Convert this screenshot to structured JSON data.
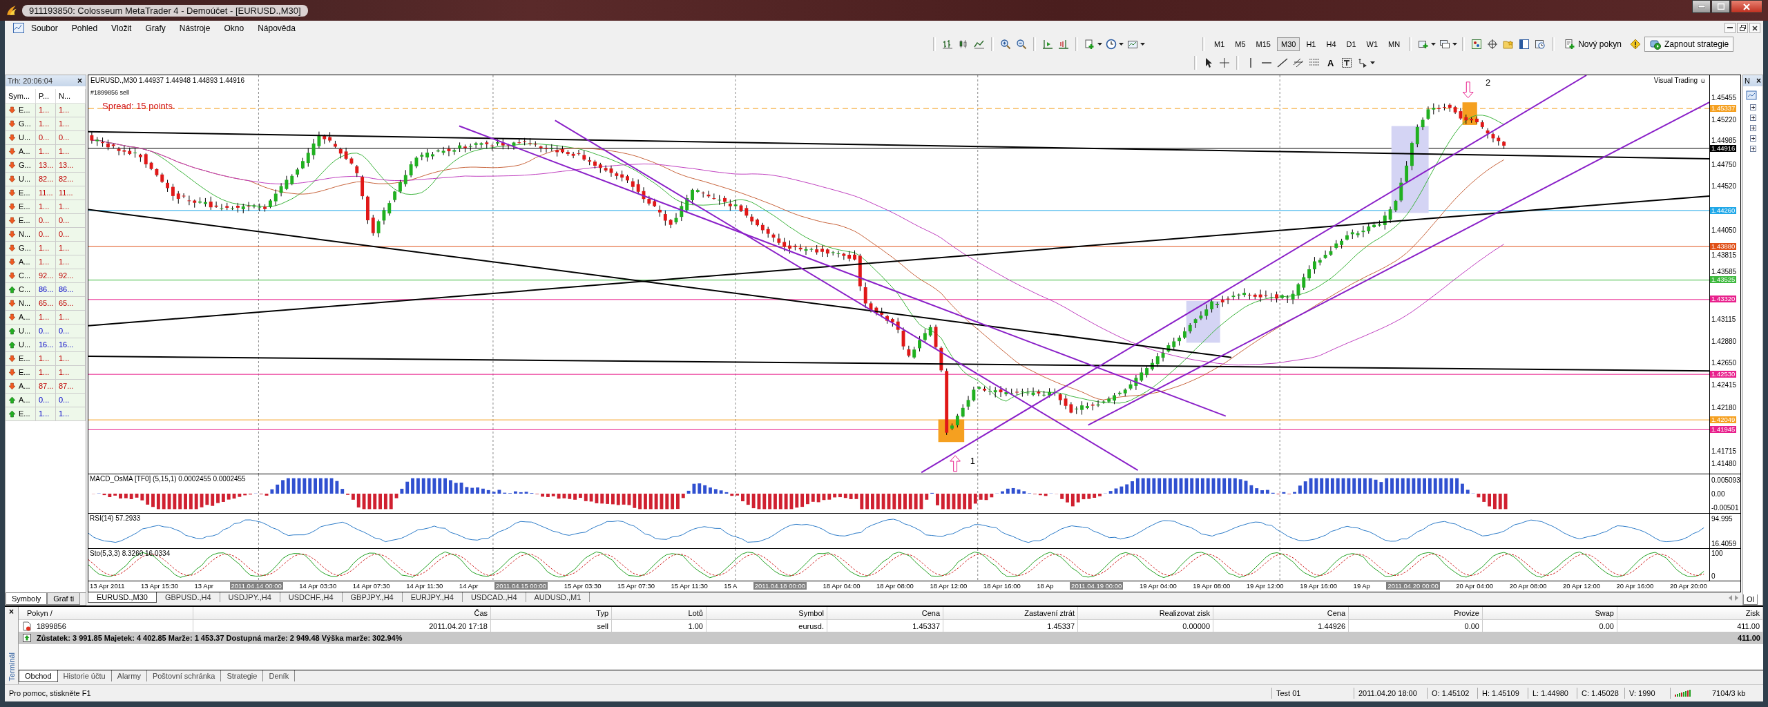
{
  "window": {
    "title": "911193850: Colosseum MetaTrader 4 - Demoúčet - [EURUSD.,M30]"
  },
  "menu": [
    "Soubor",
    "Pohled",
    "Vložit",
    "Grafy",
    "Nástroje",
    "Okno",
    "Nápověda"
  ],
  "toolbar": {
    "timeframes": [
      {
        "label": "M1",
        "selected": false
      },
      {
        "label": "M5",
        "selected": false
      },
      {
        "label": "M15",
        "selected": false
      },
      {
        "label": "M30",
        "selected": true
      },
      {
        "label": "H1",
        "selected": false
      },
      {
        "label": "H4",
        "selected": false
      },
      {
        "label": "D1",
        "selected": false
      },
      {
        "label": "W1",
        "selected": false
      },
      {
        "label": "MN",
        "selected": false
      }
    ],
    "new_order": "Nový pokyn",
    "strategies": "Zapnout strategie",
    "text_tool": "A"
  },
  "market_watch": {
    "title": "Trh: 20:06:04",
    "close": "×",
    "columns": [
      "Sym...",
      "P...",
      "N..."
    ],
    "rows": [
      {
        "symbol": "E...",
        "bid": "1...",
        "ask": "1...",
        "kind": "down"
      },
      {
        "symbol": "G...",
        "bid": "1...",
        "ask": "1...",
        "kind": "down"
      },
      {
        "symbol": "U...",
        "bid": "0...",
        "ask": "0...",
        "kind": "down"
      },
      {
        "symbol": "A...",
        "bid": "1...",
        "ask": "1...",
        "kind": "down"
      },
      {
        "symbol": "G...",
        "bid": "13...",
        "ask": "13...",
        "kind": "down"
      },
      {
        "symbol": "U...",
        "bid": "82...",
        "ask": "82...",
        "kind": "down"
      },
      {
        "symbol": "E...",
        "bid": "11...",
        "ask": "11...",
        "kind": "down"
      },
      {
        "symbol": "E...",
        "bid": "1...",
        "ask": "1...",
        "kind": "down"
      },
      {
        "symbol": "E...",
        "bid": "0...",
        "ask": "0...",
        "kind": "down"
      },
      {
        "symbol": "N...",
        "bid": "0...",
        "ask": "0...",
        "kind": "down"
      },
      {
        "symbol": "G...",
        "bid": "1...",
        "ask": "1...",
        "kind": "down"
      },
      {
        "symbol": "A...",
        "bid": "1...",
        "ask": "1...",
        "kind": "down"
      },
      {
        "symbol": "C...",
        "bid": "92...",
        "ask": "92...",
        "kind": "down"
      },
      {
        "symbol": "C...",
        "bid": "86...",
        "ask": "86...",
        "kind": "up"
      },
      {
        "symbol": "N...",
        "bid": "65...",
        "ask": "65...",
        "kind": "down"
      },
      {
        "symbol": "A...",
        "bid": "1...",
        "ask": "1...",
        "kind": "down"
      },
      {
        "symbol": "U...",
        "bid": "0...",
        "ask": "0...",
        "kind": "up"
      },
      {
        "symbol": "U...",
        "bid": "16...",
        "ask": "16...",
        "kind": "up"
      },
      {
        "symbol": "E...",
        "bid": "1...",
        "ask": "1...",
        "kind": "down"
      },
      {
        "symbol": "E...",
        "bid": "1...",
        "ask": "1...",
        "kind": "down"
      },
      {
        "symbol": "A...",
        "bid": "87...",
        "ask": "87...",
        "kind": "down"
      },
      {
        "symbol": "A...",
        "bid": "0...",
        "ask": "0...",
        "kind": "up"
      },
      {
        "symbol": "E...",
        "bid": "1...",
        "ask": "1...",
        "kind": "up"
      }
    ],
    "tabs": [
      {
        "label": "Symboly",
        "selected": true
      },
      {
        "label": "Graf ti",
        "selected": false
      }
    ]
  },
  "chart": {
    "header": "EURUSD.,M30  1.44937 1.44948 1.44893 1.44916",
    "order_label": "#1899856 sell",
    "spread": "Spread: 15 points.",
    "brand": "Visual Trading ☺",
    "annotations": [
      "1",
      "2"
    ],
    "price_axis": [
      "1.45455",
      "1.45220",
      "1.44985",
      "1.44750",
      "1.44520",
      "1.44050",
      "1.43815",
      "1.43585",
      "1.43115",
      "1.42880",
      "1.42650",
      "1.42415",
      "1.42180",
      "1.41715",
      "1.41480"
    ],
    "price_lines": [
      {
        "price": "1.45337",
        "color": "#f5a020",
        "kind": "order"
      },
      {
        "price": "1.44916",
        "color": "#000000",
        "kind": "bid"
      },
      {
        "price": "1.44260",
        "color": "#20a8e8",
        "kind": "level"
      },
      {
        "price": "1.43880",
        "color": "#e05018",
        "kind": "level"
      },
      {
        "price": "1.43525",
        "color": "#3cb83c",
        "kind": "level"
      },
      {
        "price": "1.43320",
        "color": "#e8208c",
        "kind": "level"
      },
      {
        "price": "1.42530",
        "color": "#e8208c",
        "kind": "level"
      },
      {
        "price": "1.42049",
        "color": "#f5a020",
        "kind": "level"
      },
      {
        "price": "1.41945",
        "color": "#e8208c",
        "kind": "level"
      }
    ],
    "indicators": [
      {
        "kind": "macd",
        "label": "MACD_OsMA [TF0] (5,15,1) 0.0002455 0.0002455",
        "axis": [
          "0.005093",
          "0.00",
          "-0.00501"
        ]
      },
      {
        "kind": "rsi",
        "label": "RSI(14) 57.2933",
        "axis": [
          "94.995",
          "16.4059"
        ]
      },
      {
        "kind": "sto",
        "label": "Sto(5,3,3) 8.3260 16.0334",
        "axis": [
          "100",
          "0"
        ]
      }
    ],
    "time_axis": [
      {
        "label": "13 Apr 2011",
        "kind": "tick"
      },
      {
        "label": "13 Apr 15:30",
        "kind": "tick"
      },
      {
        "label": "13 Apr",
        "kind": "tick"
      },
      {
        "label": "2011.04.14 00:00",
        "kind": "marker"
      },
      {
        "label": "14 Apr 03:30",
        "kind": "tick"
      },
      {
        "label": "14 Apr 07:30",
        "kind": "tick"
      },
      {
        "label": "14 Apr 11:30",
        "kind": "tick"
      },
      {
        "label": "14 Apr",
        "kind": "tick"
      },
      {
        "label": "2011.04.15 00:00",
        "kind": "marker"
      },
      {
        "label": "15 Apr 03:30",
        "kind": "tick"
      },
      {
        "label": "15 Apr 07:30",
        "kind": "tick"
      },
      {
        "label": "15 Apr 11:30",
        "kind": "tick"
      },
      {
        "label": "15 A",
        "kind": "tick"
      },
      {
        "label": "2011.04.18 00:00",
        "kind": "marker"
      },
      {
        "label": "18 Apr 04:00",
        "kind": "tick"
      },
      {
        "label": "18 Apr 08:00",
        "kind": "tick"
      },
      {
        "label": "18 Apr 12:00",
        "kind": "tick"
      },
      {
        "label": "18 Apr 16:00",
        "kind": "tick"
      },
      {
        "label": "18 Ap",
        "kind": "tick"
      },
      {
        "label": "2011.04.19 00:00",
        "kind": "marker"
      },
      {
        "label": "19 Apr 04:00",
        "kind": "tick"
      },
      {
        "label": "19 Apr 08:00",
        "kind": "tick"
      },
      {
        "label": "19 Apr 12:00",
        "kind": "tick"
      },
      {
        "label": "19 Apr 16:00",
        "kind": "tick"
      },
      {
        "label": "19 Ap",
        "kind": "tick"
      },
      {
        "label": "2011.04.20 00:00",
        "kind": "marker"
      },
      {
        "label": "20 Apr 04:00",
        "kind": "tick"
      },
      {
        "label": "20 Apr 08:00",
        "kind": "tick"
      },
      {
        "label": "20 Apr 12:00",
        "kind": "tick"
      },
      {
        "label": "20 Apr 16:00",
        "kind": "tick"
      },
      {
        "label": "20 Apr 20:00",
        "kind": "tick"
      }
    ]
  },
  "chart_tabs": [
    {
      "label": "EURUSD.,M30",
      "selected": true
    },
    {
      "label": "GBPUSD.,H4",
      "selected": false
    },
    {
      "label": "USDJPY.,H4",
      "selected": false
    },
    {
      "label": "USDCHF.,H4",
      "selected": false
    },
    {
      "label": "GBPJPY.,H4",
      "selected": false
    },
    {
      "label": "EURJPY.,H4",
      "selected": false
    },
    {
      "label": "USDCAD.,H4",
      "selected": false
    },
    {
      "label": "AUDUSD.,M1",
      "selected": false
    }
  ],
  "navigator": {
    "title": "N",
    "close": "×",
    "tab": "Ol"
  },
  "terminal": {
    "side_label": "Terminál",
    "close": "×",
    "columns": [
      "Pokyn  /",
      "Čas",
      "Typ",
      "Lotů",
      "Symbol",
      "Cena",
      "Zastavení ztrát",
      "Realizovat zisk",
      "Cena",
      "Provize",
      "Swap",
      "Zisk"
    ],
    "rows": [
      [
        "1899856",
        "2011.04.20 17:18",
        "sell",
        "1.00",
        "eurusd.",
        "1.45337",
        "1.45337",
        "0.00000",
        "1.44926",
        "0.00",
        "0.00",
        "411.00"
      ]
    ],
    "summary": "Zůstatek: 3 991.85  Majetek: 4 402.85  Marže: 1 453.37  Dostupná marže: 2 949.48  Výška marže: 302.94%",
    "total": "411.00",
    "tabs": [
      {
        "label": "Obchod",
        "selected": true
      },
      {
        "label": "Historie účtu",
        "selected": false
      },
      {
        "label": "Alarmy",
        "selected": false
      },
      {
        "label": "Poštovní schránka",
        "selected": false
      },
      {
        "label": "Strategie",
        "selected": false
      },
      {
        "label": "Deník",
        "selected": false
      }
    ]
  },
  "status_bar": {
    "help": "Pro pomoc, stiskněte F1",
    "fields": [
      "Test 01",
      "2011.04.20 18:00",
      "O: 1.45102",
      "H: 1.45109",
      "L: 1.44980",
      "C: 1.45028",
      "V: 1990"
    ],
    "traffic": "7104/3 kb"
  }
}
